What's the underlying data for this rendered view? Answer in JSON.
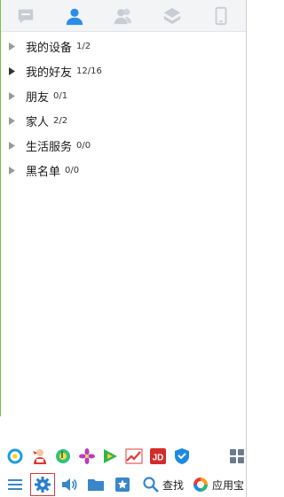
{
  "tabs": [
    {
      "name": "messages",
      "icon": "chat-bubble-icon",
      "active": false
    },
    {
      "name": "contacts",
      "icon": "person-icon",
      "active": true
    },
    {
      "name": "groups",
      "icon": "people-icon",
      "active": false
    },
    {
      "name": "discover",
      "icon": "cube-icon",
      "active": false
    },
    {
      "name": "phone",
      "icon": "phone-icon",
      "active": false
    }
  ],
  "groups": [
    {
      "name": "我的设备",
      "count": "1/2"
    },
    {
      "name": "我的好友",
      "count": "12/16"
    },
    {
      "name": "朋友",
      "count": "0/1"
    },
    {
      "name": "家人",
      "count": "2/2"
    },
    {
      "name": "生活服务",
      "count": "0/0"
    },
    {
      "name": "黑名单",
      "count": "0/0"
    }
  ],
  "apps": [
    {
      "icon": "qq-browser-icon"
    },
    {
      "icon": "qq-game-icon"
    },
    {
      "icon": "qq-music-icon"
    },
    {
      "icon": "flower-icon"
    },
    {
      "icon": "video-play-icon"
    },
    {
      "icon": "stock-chart-icon"
    },
    {
      "icon": "jd-icon"
    },
    {
      "icon": "security-shield-icon"
    },
    {
      "icon": "grid-apps-icon"
    }
  ],
  "toolbar": {
    "search_label": "查找",
    "appstore_label": "应用宝"
  },
  "colors": {
    "accent": "#2a8ee8",
    "inactive_icon": "#c9ccd2",
    "settings_highlight": "#d23b3b",
    "left_border": "#7fbf3f"
  }
}
